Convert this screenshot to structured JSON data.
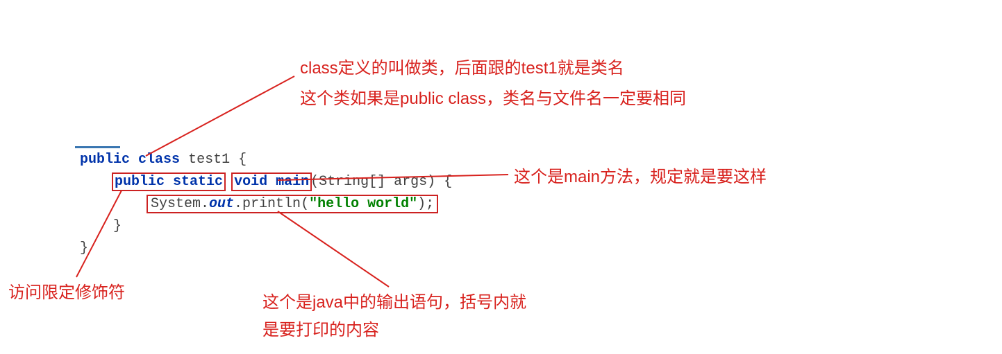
{
  "code": {
    "line1": {
      "public": "public",
      "class": "class",
      "name": "test1",
      "brace": " {"
    },
    "line2": {
      "indent": "    ",
      "ps": "public static",
      "space": " ",
      "vm": "void main",
      "args": "(String[] args) {"
    },
    "line3": {
      "indent": "        ",
      "sys": "System.",
      "out": "out",
      "pr": ".println(",
      "str": "\"hello world\"",
      "end": ");"
    },
    "line4": "    }",
    "line5": "}"
  },
  "annotations": {
    "top1": "class定义的叫做类，后面跟的test1就是类名",
    "top2": "这个类如果是public class，类名与文件名一定要相同",
    "right": "这个是main方法，规定就是要这样",
    "bottom_left": "访问限定修饰符",
    "bottom1": "这个是java中的输出语句，括号内就",
    "bottom2": "是要打印的内容"
  }
}
